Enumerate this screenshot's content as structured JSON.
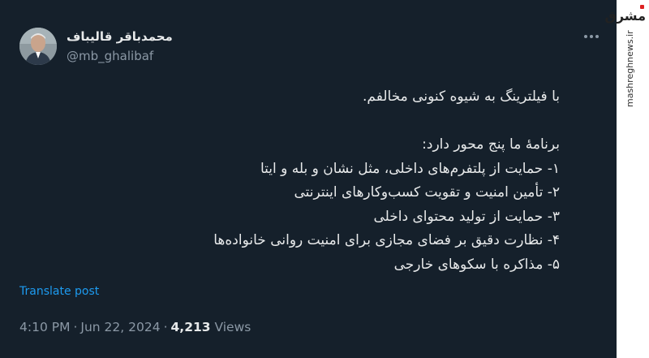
{
  "author": {
    "name": "محمدباقر قالیباف",
    "handle": "@mb_ghalibaf"
  },
  "post": {
    "lines": [
      "با فیلترینگ به شیوه کنونی مخالفم.",
      "",
      "برنامهٔ ما پنج محور دارد:",
      "۱- حمایت از پلتفرم‌های  داخلی، مثل نشان و بله و ایتا",
      "۲- تأمین امنیت  و تقویت کسب‌وکارهای اینترنتی",
      "۳- حمایت از تولید محتوای داخلی",
      "۴- نظارت دقیق بر فضای مجازی برای امنیت روانی خانواده‌ها",
      "۵- مذاکره با سکوهای خارجی"
    ],
    "translate_label": "Translate post",
    "time": "4:10 PM",
    "date": "Jun 22, 2024",
    "views_count": "4,213",
    "views_label": "Views"
  },
  "watermark": {
    "logo_text": "مشرق",
    "site": "mashreghnews.ir"
  },
  "colors": {
    "background": "#15202b",
    "text": "#e7e9ea",
    "muted": "#8b98a5",
    "link": "#1d9bf0"
  },
  "icons": [
    "avatar",
    "more-options-icon"
  ]
}
